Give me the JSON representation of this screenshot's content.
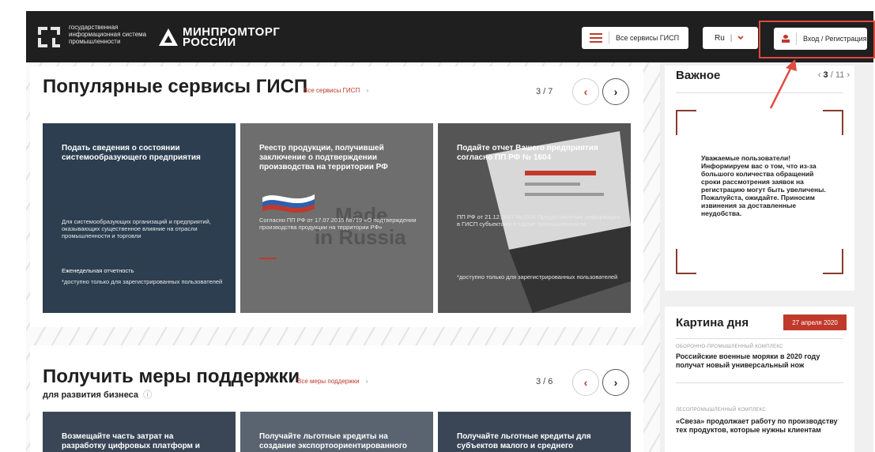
{
  "header": {
    "gisp_text": "государственная информационная система промышленности",
    "ministry_line1": "МИНПРОМТОРГ",
    "ministry_line2": "РОССИИ",
    "services_label": "Все сервисы ГИСП",
    "lang_code": "Ru",
    "login_label": "Вход / Регистрация",
    "accent_color": "#c0392b"
  },
  "popular": {
    "title": "Популярные сервисы ГИСП",
    "link": "Все сервисы ГИСП",
    "link_arrow": "›",
    "pager": "3 / 7",
    "prev": "‹",
    "next": "›",
    "tiles": [
      {
        "title": "Подать сведения о состоянии системообразующего предприятия",
        "text": "Для системообразующих организаций и предприятий, оказывающих существенное влияние на отрасли промышленности и торговли",
        "extra": "Еженедельная отчетность",
        "note": "*доступно только для зарегистрированных пользователей"
      },
      {
        "title": "Реестр продукции, получившей заключение о подтверждении производства на территории РФ",
        "text": "Согласно ПП РФ от 17.07.2015 №719 «О подтверждении производства продукции на территории РФ»",
        "watermark1": "Made",
        "watermark2": "in Russia"
      },
      {
        "title": "Подайте отчет Вашего предприятия согласно ПП РФ № 1604",
        "text": "ПП РФ от 21.12.2017 №1604 Предоставление информации в ГИСП субъектами в сфере промышленности",
        "note": "*доступно только для зарегистрированных пользователей"
      }
    ]
  },
  "support": {
    "title": "Получить меры поддержки",
    "subtitle": "для развития бизнеса",
    "info_icon": "ⓘ",
    "link": "Все меры поддержки",
    "link_arrow": "›",
    "pager": "3 / 6",
    "prev": "‹",
    "next": "›",
    "tiles": [
      {
        "title": "Возмещайте часть затрат на разработку цифровых платформ и"
      },
      {
        "title": "Получайте льготные кредиты на создание экспортоориентированного"
      },
      {
        "title": "Получайте льготные кредиты для субъектов малого и среднего"
      }
    ]
  },
  "important": {
    "title": "Важное",
    "pager_prev": "‹",
    "pager_current": "3",
    "pager_total": "/ 11",
    "pager_next": "›",
    "message": "Уважаемые пользователи! Информируем вас о том, что из-за большого количества обращений сроки рассмотрения заявок на регистрацию могут быть увеличены. Пожалуйста, ожидайте. Приносим извинения за доставленные неудобства."
  },
  "day": {
    "title": "Картина дня",
    "date": "27 апреля 2020",
    "news": [
      {
        "category": "ОБОРОННО-ПРОМЫШЛЕННЫЙ КОМПЛЕКС",
        "title": "Российские военные моряки в 2020 году получат новый универсальный нож"
      },
      {
        "category": "ЛЕСОПРОМЫШЛЕННЫЙ КОМПЛЕКС",
        "title": "«Свеза» продолжает работу по производству тех продуктов, которые нужны клиентам"
      }
    ]
  },
  "colors": {
    "header_bg": "#1f1f1f",
    "accent": "#c0392b",
    "highlight": "#e04a3f"
  }
}
